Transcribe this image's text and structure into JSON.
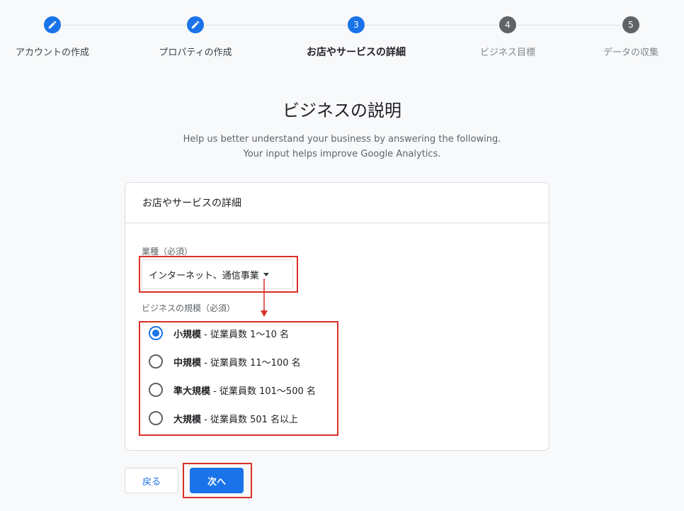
{
  "stepper": {
    "steps": [
      {
        "label": "アカウントの作成",
        "state": "done",
        "number": ""
      },
      {
        "label": "プロパティの作成",
        "state": "done",
        "number": ""
      },
      {
        "label": "お店やサービスの詳細",
        "state": "current",
        "number": "3"
      },
      {
        "label": "ビジネス目標",
        "state": "todo",
        "number": "4"
      },
      {
        "label": "データの収集",
        "state": "todo",
        "number": "5"
      }
    ]
  },
  "page": {
    "title": "ビジネスの説明",
    "subtitle_line1": "Help us better understand your business by answering the following.",
    "subtitle_line2": "Your input helps improve Google Analytics."
  },
  "card": {
    "header": "お店やサービスの詳細",
    "industry_label": "業種（必須）",
    "industry_value": "インターネット、通信事業",
    "size_label": "ビジネスの規模（必須）",
    "size_options": [
      {
        "main": "小規模",
        "detail": " - 従業員数 1〜10 名",
        "checked": true
      },
      {
        "main": "中規模",
        "detail": " - 従業員数 11〜100 名",
        "checked": false
      },
      {
        "main": "準大規模",
        "detail": " - 従業員数 101〜500 名",
        "checked": false
      },
      {
        "main": "大規模",
        "detail": " - 従業員数 501 名以上",
        "checked": false
      }
    ]
  },
  "buttons": {
    "back": "戻る",
    "next": "次へ"
  },
  "colors": {
    "accent": "#1a73e8",
    "annotation": "#d93025",
    "todo_step": "#5f6368"
  },
  "icons": {
    "done_step": "pencil-icon",
    "dropdown": "caret-down-icon",
    "annotation": "arrow-down-icon"
  }
}
